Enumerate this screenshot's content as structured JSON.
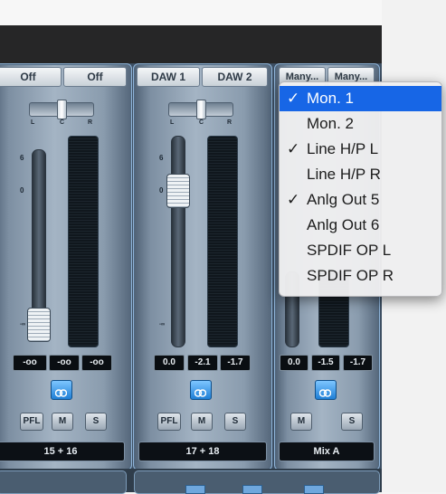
{
  "strip1": {
    "route": [
      "Off",
      "Off"
    ],
    "pan_scale": [
      "L",
      "C",
      "R"
    ],
    "fader_scale": [
      "6",
      "0",
      "-∞"
    ],
    "readouts": [
      "-oo",
      "-oo",
      "-oo"
    ],
    "buttons": [
      "PFL",
      "M",
      "S"
    ],
    "name": "15 + 16"
  },
  "strip2": {
    "route": [
      "DAW 1",
      "DAW 2"
    ],
    "pan_scale": [
      "L",
      "C",
      "R"
    ],
    "fader_scale": [
      "6",
      "0",
      "-∞"
    ],
    "readouts": [
      "0.0",
      "-2.1",
      "-1.7"
    ],
    "buttons": [
      "PFL",
      "M",
      "S"
    ],
    "name": "17 + 18"
  },
  "strip3": {
    "route": [
      "Many...",
      "Many..."
    ],
    "readouts": [
      "0.0",
      "-1.5",
      "-1.7"
    ],
    "buttons": [
      "M",
      "S"
    ],
    "name": "Mix A"
  },
  "menu": {
    "items": [
      {
        "label": "Mon. 1",
        "check": "✓"
      },
      {
        "label": "Mon. 2",
        "check": ""
      },
      {
        "label": "Line H/P L",
        "check": "✓"
      },
      {
        "label": "Line H/P R",
        "check": ""
      },
      {
        "label": "Anlg Out 5",
        "check": "✓"
      },
      {
        "label": "Anlg Out 6",
        "check": ""
      },
      {
        "label": "SPDIF OP L",
        "check": ""
      },
      {
        "label": "SPDIF OP R",
        "check": ""
      }
    ],
    "highlighted": "Mon. 1"
  },
  "colors": {
    "menu_highlight": "#1766e6",
    "link_button": "#2a8ae0",
    "strip_border": "#8fb4d9"
  },
  "icons": {
    "link": "stereo-link-icon"
  }
}
